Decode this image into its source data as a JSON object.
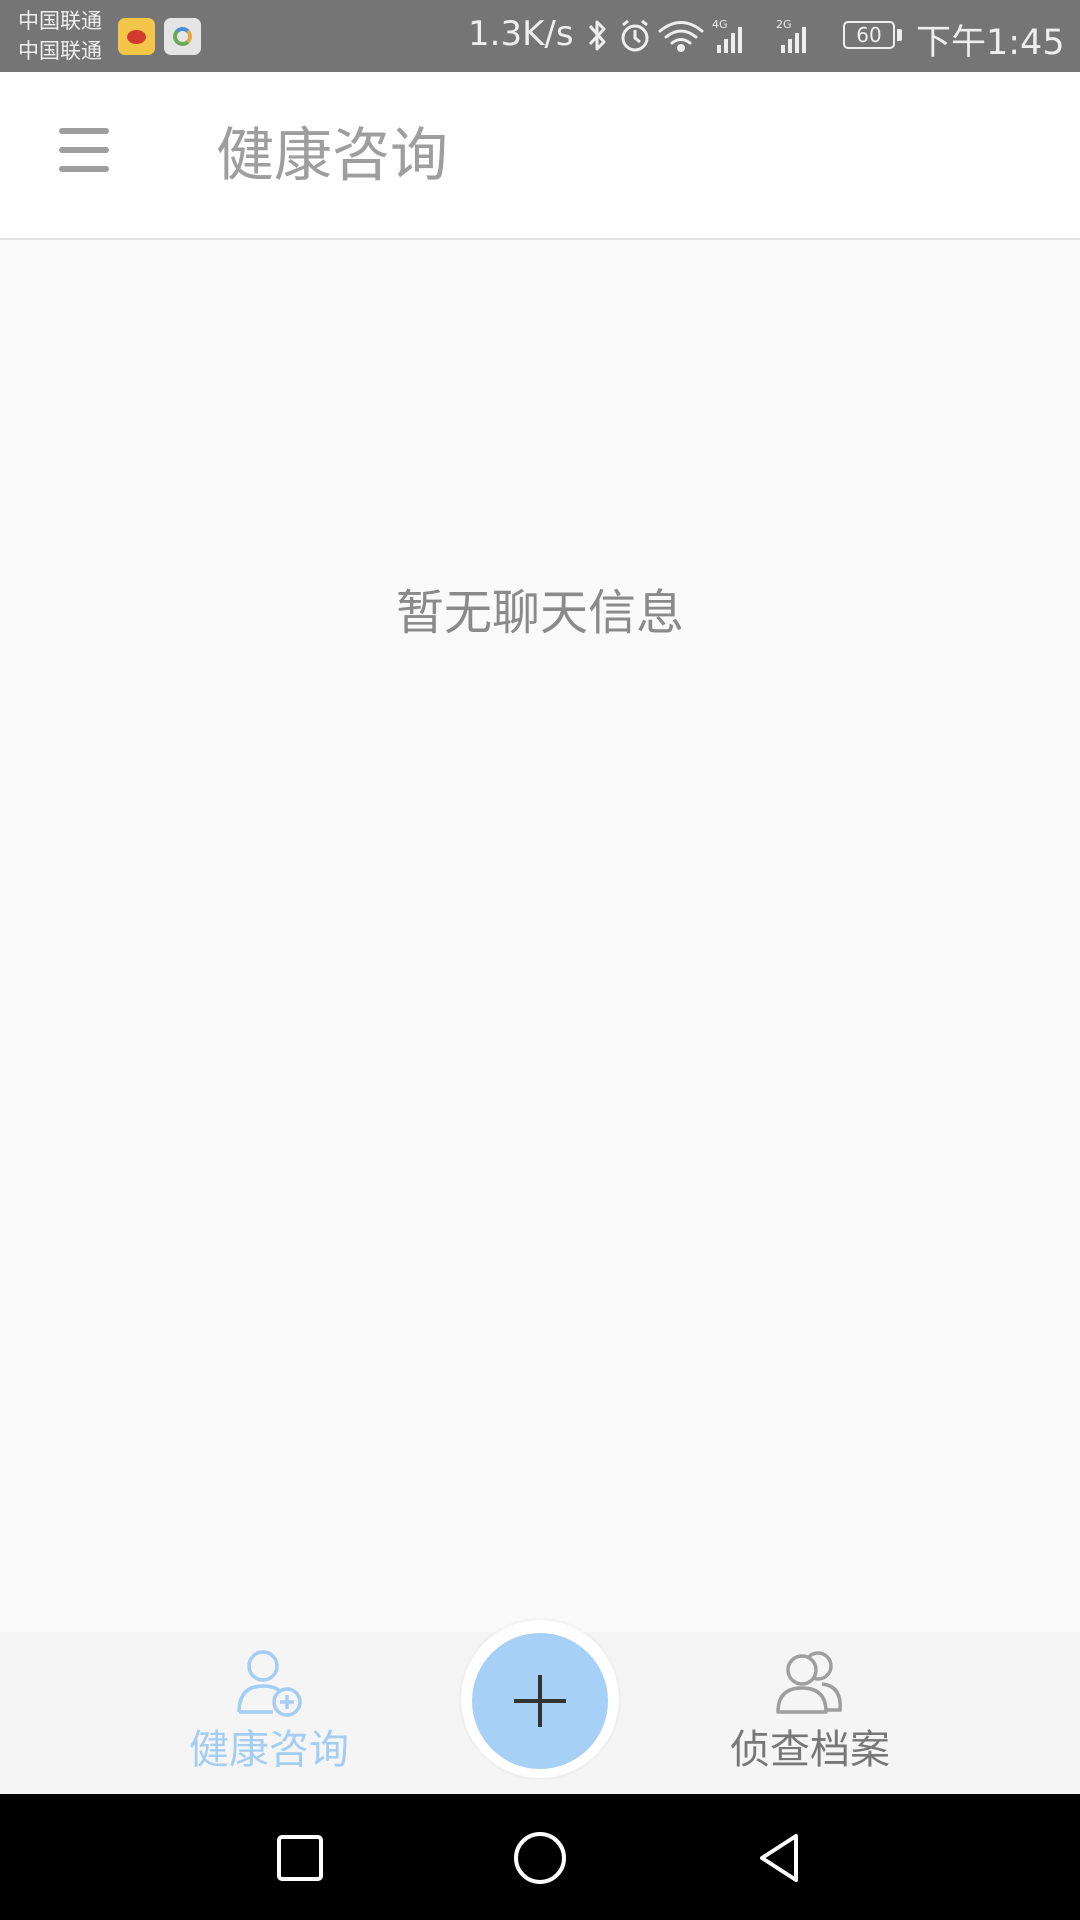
{
  "status_bar": {
    "carrier_1": "中国联通",
    "carrier_2": "中国联通",
    "net_speed": "1.3K/s",
    "signal_1_label": "4G",
    "signal_2_label": "2G",
    "battery": "60",
    "time": "下午1:45",
    "icons": [
      "weibo-icon",
      "app-icon",
      "bluetooth-icon",
      "alarm-icon",
      "wifi-icon",
      "signal-icon",
      "signal-icon",
      "battery-icon"
    ]
  },
  "app_bar": {
    "menu_icon": "menu-icon",
    "title": "健康咨询"
  },
  "main": {
    "empty_message": "暂无聊天信息"
  },
  "bottom_nav": {
    "items": [
      {
        "label": "健康咨询",
        "icon": "user-add-icon",
        "active": true
      },
      {
        "label": "侦查档案",
        "icon": "users-icon",
        "active": false
      }
    ],
    "fab_icon": "plus-icon"
  },
  "system_nav": {
    "icons": [
      "recent-apps-icon",
      "home-icon",
      "back-icon"
    ]
  },
  "colors": {
    "status_bar_bg": "#757575",
    "active_blue": "#a3cdf3",
    "fab_blue": "#a7d0f7",
    "inactive_gray": "#777777"
  }
}
